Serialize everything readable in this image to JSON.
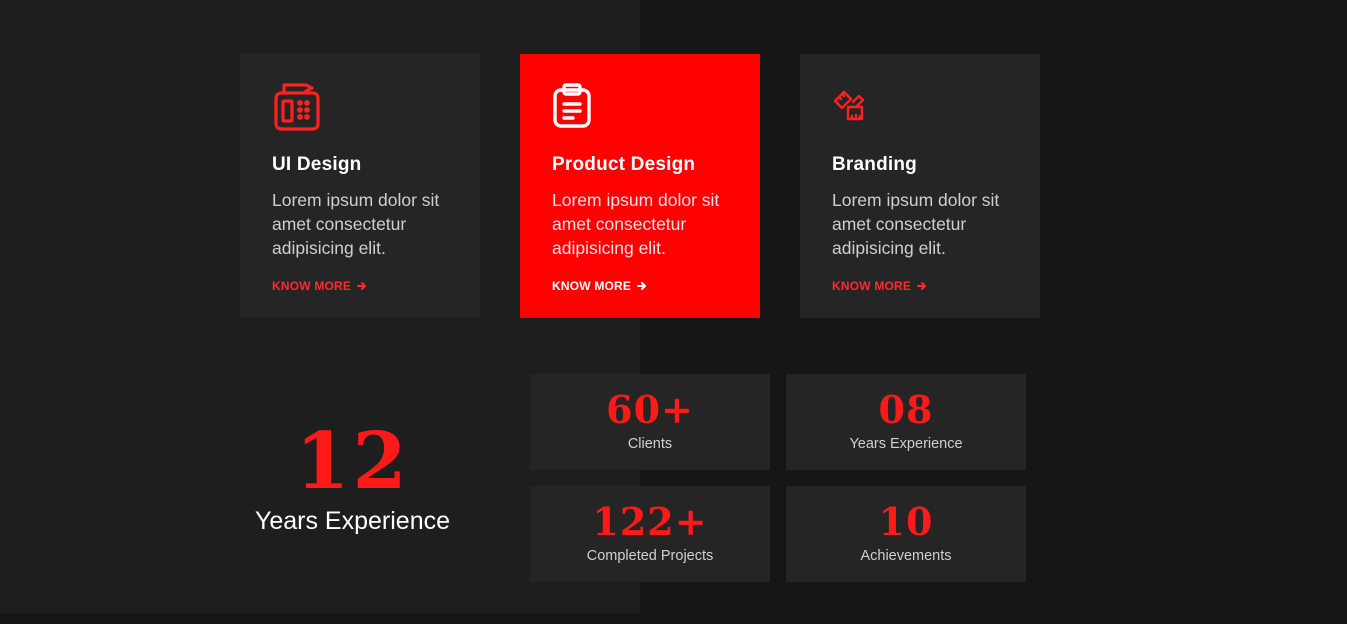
{
  "colors": {
    "accent": "#ff0000",
    "card_bg": "#252525",
    "page_bg": "#161616",
    "panel_bg": "#1e1e1e"
  },
  "services": [
    {
      "title": "UI Design",
      "text": "Lorem ipsum dolor sit amet consectetur adipisicing elit.",
      "link": "KNOW MORE",
      "icon": "pos-terminal-icon"
    },
    {
      "title": "Product Design",
      "text": "Lorem ipsum dolor sit amet consectetur adipisicing elit.",
      "link": "KNOW MORE",
      "icon": "clipboard-icon",
      "active": true
    },
    {
      "title": "Branding",
      "text": "Lorem ipsum dolor sit amet consectetur adipisicing elit.",
      "link": "KNOW MORE",
      "icon": "ruler-pencil-icon"
    }
  ],
  "experience": {
    "number": "12",
    "label": "Years Experience"
  },
  "stats": [
    {
      "number": "60+",
      "label": "Clients"
    },
    {
      "number": "08",
      "label": "Years Experience"
    },
    {
      "number": "122+",
      "label": "Completed Projects"
    },
    {
      "number": "10",
      "label": "Achievements"
    }
  ]
}
